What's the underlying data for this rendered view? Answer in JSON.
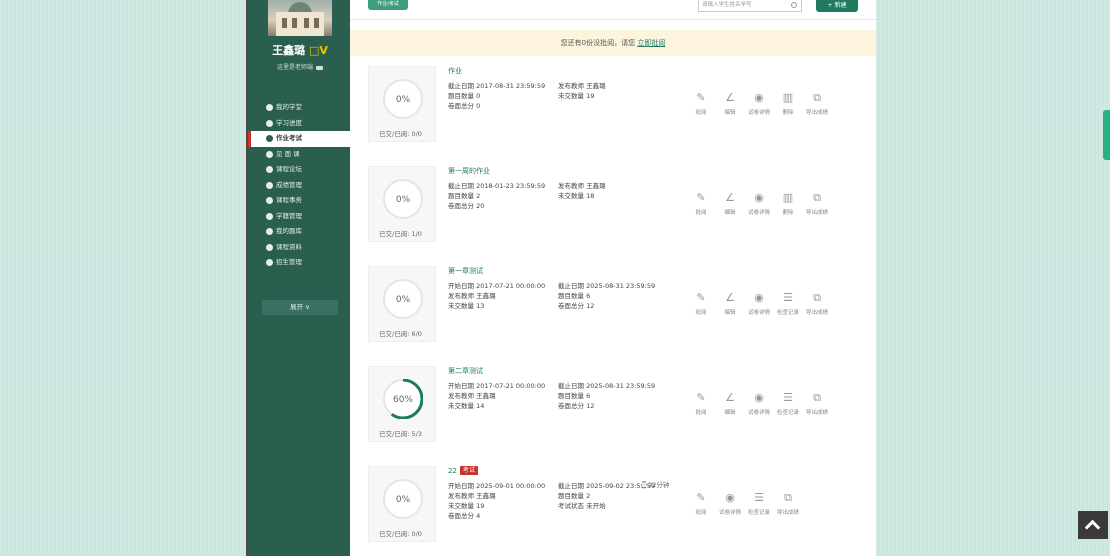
{
  "sidebar": {
    "user_name": "王鑫璐",
    "vip_mark": "□V",
    "subtitle": "这里是老师端",
    "items": [
      {
        "label": "我的学堂",
        "active": false
      },
      {
        "label": "学习进度",
        "active": false
      },
      {
        "label": "作业考试",
        "active": true
      },
      {
        "label": "见 面 课",
        "active": false
      },
      {
        "label": "课程论坛",
        "active": false
      },
      {
        "label": "成绩管理",
        "active": false
      },
      {
        "label": "课程事务",
        "active": false
      },
      {
        "label": "学籍管理",
        "active": false
      },
      {
        "label": "我的题库",
        "active": false
      },
      {
        "label": "课程资料",
        "active": false
      },
      {
        "label": "招生管理",
        "active": false
      }
    ],
    "expand_label": "展开 ∨"
  },
  "topbar": {
    "left_button": "作业/考试",
    "search_placeholder": "请输入学生姓名学号",
    "new_button": "+ 新建"
  },
  "notice": {
    "text": "您还有0份没批阅，请您 ",
    "link": "立即批阅"
  },
  "cards": [
    {
      "title": "作业",
      "badge": "",
      "percent": "0%",
      "progress": 0,
      "stat": "已交/已阅: 0/0",
      "lines": [
        {
          "left": "截止日期  2017-08-31 23:59:59",
          "right": "发布教师 王鑫璐"
        },
        {
          "left": "题目数量 0",
          "right": "未交数量 19"
        },
        {
          "left": "卷面总分 0",
          "right": ""
        }
      ],
      "clock": "",
      "actions": [
        {
          "icon": "edit-icon",
          "glyph": "✎",
          "label": "批阅"
        },
        {
          "icon": "pen-icon",
          "glyph": "∠",
          "label": "编辑"
        },
        {
          "icon": "eye-icon",
          "glyph": "◉",
          "label": "试卷详情"
        },
        {
          "icon": "trash-icon",
          "glyph": "▥",
          "label": "删除"
        },
        {
          "icon": "export-icon",
          "glyph": "⧉",
          "label": "导出成绩"
        }
      ]
    },
    {
      "title": "第一周的作业",
      "badge": "",
      "percent": "0%",
      "progress": 0,
      "stat": "已交/已阅: 1/0",
      "lines": [
        {
          "left": "截止日期  2018-01-23 23:59:59",
          "right": "发布教师 王鑫璐"
        },
        {
          "left": "题目数量 2",
          "right": "未交数量 18"
        },
        {
          "left": "卷面总分 20",
          "right": ""
        }
      ],
      "clock": "",
      "actions": [
        {
          "icon": "edit-icon",
          "glyph": "✎",
          "label": "批阅"
        },
        {
          "icon": "pen-icon",
          "glyph": "∠",
          "label": "编辑"
        },
        {
          "icon": "eye-icon",
          "glyph": "◉",
          "label": "试卷详情"
        },
        {
          "icon": "trash-icon",
          "glyph": "▥",
          "label": "删除"
        },
        {
          "icon": "export-icon",
          "glyph": "⧉",
          "label": "导出成绩"
        }
      ]
    },
    {
      "title": "第一章测试",
      "badge": "",
      "percent": "0%",
      "progress": 0,
      "stat": "已交/已阅: 6/0",
      "lines": [
        {
          "left": "开始日期 2017-07-21 00:00:00",
          "right": "截止日期  2025-08-31 23:59:59"
        },
        {
          "left": "发布教师 王鑫璐",
          "right": "题目数量 6"
        },
        {
          "left": "未交数量 13",
          "right": "卷面总分 12"
        }
      ],
      "clock": "",
      "actions": [
        {
          "icon": "edit-icon",
          "glyph": "✎",
          "label": "批阅"
        },
        {
          "icon": "pen-icon",
          "glyph": "∠",
          "label": "编辑"
        },
        {
          "icon": "eye-icon",
          "glyph": "◉",
          "label": "试卷详情"
        },
        {
          "icon": "list-icon",
          "glyph": "☰",
          "label": "检查记录"
        },
        {
          "icon": "export-icon",
          "glyph": "⧉",
          "label": "导出成绩"
        }
      ]
    },
    {
      "title": "第二章测试",
      "badge": "",
      "percent": "60%",
      "progress": 0.6,
      "stat": "已交/已阅: 5/3",
      "lines": [
        {
          "left": "开始日期 2017-07-21 00:00:00",
          "right": "截止日期  2025-08-31 23:59:59"
        },
        {
          "left": "发布教师 王鑫璐",
          "right": "题目数量 6"
        },
        {
          "left": "未交数量 14",
          "right": "卷面总分 12"
        }
      ],
      "clock": "",
      "actions": [
        {
          "icon": "edit-icon",
          "glyph": "✎",
          "label": "批阅"
        },
        {
          "icon": "pen-icon",
          "glyph": "∠",
          "label": "编辑"
        },
        {
          "icon": "eye-icon",
          "glyph": "◉",
          "label": "试卷详情"
        },
        {
          "icon": "list-icon",
          "glyph": "☰",
          "label": "检查记录"
        },
        {
          "icon": "export-icon",
          "glyph": "⧉",
          "label": "导出成绩"
        }
      ]
    },
    {
      "title": "22",
      "badge": "考试",
      "percent": "0%",
      "progress": 0,
      "stat": "已交/已阅: 0/0",
      "lines": [
        {
          "left": "开始日期 2025-09-01 00:00:00",
          "right": "截止日期 2025-09-02 23:59:59"
        },
        {
          "left": "发布教师 王鑫璐",
          "right": "题目数量 2"
        },
        {
          "left": "未交数量 19",
          "right": "考试状态 未开始"
        },
        {
          "left": "卷面总分 4",
          "right": ""
        }
      ],
      "clock": "⌚22分钟",
      "actions": [
        {
          "icon": "edit-icon",
          "glyph": "✎",
          "label": "批阅"
        },
        {
          "icon": "eye-icon",
          "glyph": "◉",
          "label": "试卷详情"
        },
        {
          "icon": "list-icon",
          "glyph": "☰",
          "label": "检查记录"
        },
        {
          "icon": "export-icon",
          "glyph": "⧉",
          "label": "导出成绩"
        }
      ]
    }
  ],
  "colors": {
    "accent": "#1f7a60",
    "sidebar": "#2a5e4e",
    "badge": "#c8332e"
  }
}
